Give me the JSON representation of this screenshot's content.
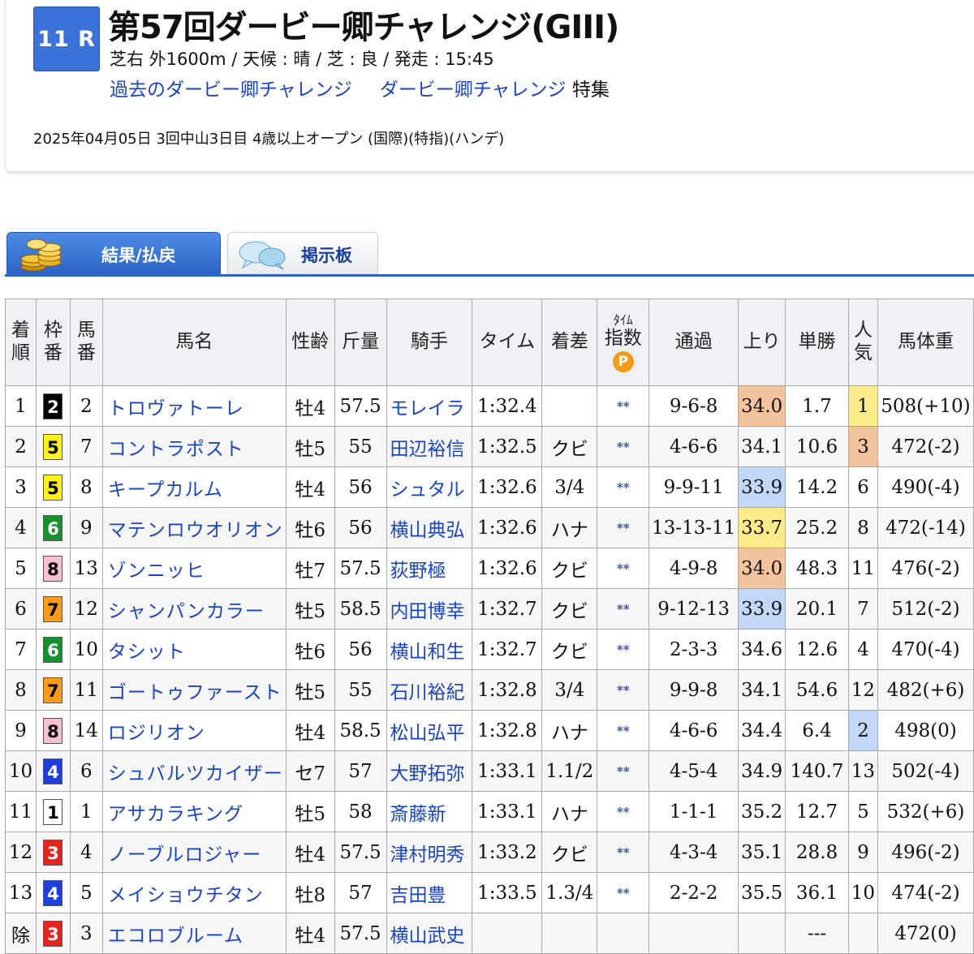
{
  "race": {
    "number": "11 R",
    "title": "第57回ダービー卿チャレンジ(GIII)",
    "info": "芝右 外1600m /  天候 : 晴 /  芝 : 良  /  発走 : 15:45",
    "past_link": "過去のダービー卿チャレンジ",
    "feature_link": "ダービー卿チャレンジ",
    "feature_suffix": "特集",
    "date_line": "2025年04月05日 3回中山3日目 4歳以上オープン  (国際)(特指)(ハンデ)"
  },
  "tabs": [
    {
      "label": "結果/払戻",
      "icon": "gold-coins-icon",
      "active": true
    },
    {
      "label": "掲示板",
      "icon": "speech-bubbles-icon",
      "active": false
    }
  ],
  "table": {
    "headers": {
      "rank": [
        "着",
        "順"
      ],
      "waku": [
        "枠",
        "番"
      ],
      "umaban": [
        "馬",
        "番"
      ],
      "horse": "馬名",
      "sex_age": "性齢",
      "weight": "斤量",
      "jockey": "騎手",
      "time": "タイム",
      "margin": "着差",
      "index_top": "ﾀｲﾑ",
      "index": "指数",
      "index_badge": "P",
      "passing": "通過",
      "last3f": "上り",
      "odds": "単勝",
      "popularity": [
        "人",
        "気"
      ],
      "body_weight": "馬体重"
    },
    "waku_colors": {
      "1": {
        "bg": "#ffffff",
        "fg": "#000000"
      },
      "2": {
        "bg": "#000000",
        "fg": "#ffffff"
      },
      "3": {
        "bg": "#e8231f",
        "fg": "#ffffff"
      },
      "4": {
        "bg": "#1f3fdc",
        "fg": "#ffffff"
      },
      "5": {
        "bg": "#ffef1a",
        "fg": "#000000"
      },
      "6": {
        "bg": "#15922f",
        "fg": "#ffffff"
      },
      "7": {
        "bg": "#f99b16",
        "fg": "#000000"
      },
      "8": {
        "bg": "#f8bfd1",
        "fg": "#000000"
      }
    },
    "rows": [
      {
        "rank": "1",
        "waku": "2",
        "umaban": "2",
        "horse": "トロヴァトーレ",
        "sex_age": "牡4",
        "weight": "57.5",
        "jockey": "モレイラ",
        "time": "1:32.4",
        "margin": "",
        "index": "**",
        "passing": "9-6-8",
        "last3f": "34.0",
        "last3f_hl": "orange",
        "odds": "1.7",
        "pop": "1",
        "pop_hl": "yellow",
        "body_weight": "508(+10)"
      },
      {
        "rank": "2",
        "waku": "5",
        "umaban": "7",
        "horse": "コントラポスト",
        "sex_age": "牡5",
        "weight": "55",
        "jockey": "田辺裕信",
        "time": "1:32.5",
        "margin": "クビ",
        "index": "**",
        "passing": "4-6-6",
        "last3f": "34.1",
        "last3f_hl": "",
        "odds": "10.6",
        "pop": "3",
        "pop_hl": "orange",
        "body_weight": "472(-2)"
      },
      {
        "rank": "3",
        "waku": "5",
        "umaban": "8",
        "horse": "キープカルム",
        "sex_age": "牡4",
        "weight": "56",
        "jockey": "シュタル",
        "time": "1:32.6",
        "margin": "3/4",
        "index": "**",
        "passing": "9-9-11",
        "last3f": "33.9",
        "last3f_hl": "blue",
        "odds": "14.2",
        "pop": "6",
        "pop_hl": "",
        "body_weight": "490(-4)"
      },
      {
        "rank": "4",
        "waku": "6",
        "umaban": "9",
        "horse": "マテンロウオリオン",
        "sex_age": "牡6",
        "weight": "56",
        "jockey": "横山典弘",
        "time": "1:32.6",
        "margin": "ハナ",
        "index": "**",
        "passing": "13-13-11",
        "last3f": "33.7",
        "last3f_hl": "yellow",
        "odds": "25.2",
        "pop": "8",
        "pop_hl": "",
        "body_weight": "472(-14)"
      },
      {
        "rank": "5",
        "waku": "8",
        "umaban": "13",
        "horse": "ゾンニッヒ",
        "sex_age": "牡7",
        "weight": "57.5",
        "jockey": "荻野極",
        "time": "1:32.6",
        "margin": "クビ",
        "index": "**",
        "passing": "4-9-8",
        "last3f": "34.0",
        "last3f_hl": "orange",
        "odds": "48.3",
        "pop": "11",
        "pop_hl": "",
        "body_weight": "476(-2)"
      },
      {
        "rank": "6",
        "waku": "7",
        "umaban": "12",
        "horse": "シャンパンカラー",
        "sex_age": "牡5",
        "weight": "58.5",
        "jockey": "内田博幸",
        "time": "1:32.7",
        "margin": "クビ",
        "index": "**",
        "passing": "9-12-13",
        "last3f": "33.9",
        "last3f_hl": "blue",
        "odds": "20.1",
        "pop": "7",
        "pop_hl": "",
        "body_weight": "512(-2)"
      },
      {
        "rank": "7",
        "waku": "6",
        "umaban": "10",
        "horse": "タシット",
        "sex_age": "牡6",
        "weight": "56",
        "jockey": "横山和生",
        "time": "1:32.7",
        "margin": "クビ",
        "index": "**",
        "passing": "2-3-3",
        "last3f": "34.6",
        "last3f_hl": "",
        "odds": "12.6",
        "pop": "4",
        "pop_hl": "",
        "body_weight": "470(-4)"
      },
      {
        "rank": "8",
        "waku": "7",
        "umaban": "11",
        "horse": "ゴートゥファースト",
        "sex_age": "牡5",
        "weight": "55",
        "jockey": "石川裕紀",
        "time": "1:32.8",
        "margin": "3/4",
        "index": "**",
        "passing": "9-9-8",
        "last3f": "34.1",
        "last3f_hl": "",
        "odds": "54.6",
        "pop": "12",
        "pop_hl": "",
        "body_weight": "482(+6)"
      },
      {
        "rank": "9",
        "waku": "8",
        "umaban": "14",
        "horse": "ロジリオン",
        "sex_age": "牡4",
        "weight": "58.5",
        "jockey": "松山弘平",
        "time": "1:32.8",
        "margin": "ハナ",
        "index": "**",
        "passing": "4-6-6",
        "last3f": "34.4",
        "last3f_hl": "",
        "odds": "6.4",
        "pop": "2",
        "pop_hl": "blue",
        "body_weight": "498(0)"
      },
      {
        "rank": "10",
        "waku": "4",
        "umaban": "6",
        "horse": "シュバルツカイザー",
        "sex_age": "セ7",
        "weight": "57",
        "jockey": "大野拓弥",
        "time": "1:33.1",
        "margin": "1.1/2",
        "index": "**",
        "passing": "4-5-4",
        "last3f": "34.9",
        "last3f_hl": "",
        "odds": "140.7",
        "pop": "13",
        "pop_hl": "",
        "body_weight": "502(-4)"
      },
      {
        "rank": "11",
        "waku": "1",
        "umaban": "1",
        "horse": "アサカラキング",
        "sex_age": "牡5",
        "weight": "58",
        "jockey": "斎藤新",
        "time": "1:33.1",
        "margin": "ハナ",
        "index": "**",
        "passing": "1-1-1",
        "last3f": "35.2",
        "last3f_hl": "",
        "odds": "12.7",
        "pop": "5",
        "pop_hl": "",
        "body_weight": "532(+6)"
      },
      {
        "rank": "12",
        "waku": "3",
        "umaban": "4",
        "horse": "ノーブルロジャー",
        "sex_age": "牡4",
        "weight": "57.5",
        "jockey": "津村明秀",
        "time": "1:33.2",
        "margin": "クビ",
        "index": "**",
        "passing": "4-3-4",
        "last3f": "35.1",
        "last3f_hl": "",
        "odds": "28.8",
        "pop": "9",
        "pop_hl": "",
        "body_weight": "496(-2)"
      },
      {
        "rank": "13",
        "waku": "4",
        "umaban": "5",
        "horse": "メイショウチタン",
        "sex_age": "牡8",
        "weight": "57",
        "jockey": "吉田豊",
        "time": "1:33.5",
        "margin": "1.3/4",
        "index": "**",
        "passing": "2-2-2",
        "last3f": "35.5",
        "last3f_hl": "",
        "odds": "36.1",
        "pop": "10",
        "pop_hl": "",
        "body_weight": "474(-2)"
      },
      {
        "rank": "除",
        "waku": "3",
        "umaban": "3",
        "horse": "エコロブルーム",
        "sex_age": "牡4",
        "weight": "57.5",
        "jockey": "横山武史",
        "time": "",
        "margin": "",
        "index": "",
        "passing": "",
        "last3f": "",
        "last3f_hl": "",
        "odds": "---",
        "pop": "",
        "pop_hl": "",
        "body_weight": "472(0)"
      }
    ]
  }
}
